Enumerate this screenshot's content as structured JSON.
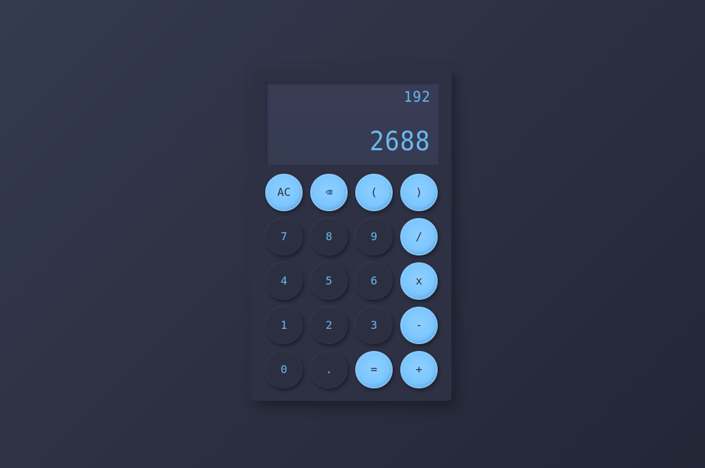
{
  "display": {
    "expression": "192",
    "value": "2688"
  },
  "colors": {
    "accent": "#7cc6ff",
    "digit_text": "#6cb8f0",
    "body": "#2d3143",
    "background": "#2c3042"
  },
  "keys": {
    "clear": "AC",
    "backspace": "⌫",
    "open_paren": "(",
    "close_paren": ")",
    "seven": "7",
    "eight": "8",
    "nine": "9",
    "divide": "/",
    "four": "4",
    "five": "5",
    "six": "6",
    "multiply": "x",
    "one": "1",
    "two": "2",
    "three": "3",
    "subtract": "-",
    "zero": "0",
    "decimal": ".",
    "equals": "=",
    "add": "+"
  }
}
